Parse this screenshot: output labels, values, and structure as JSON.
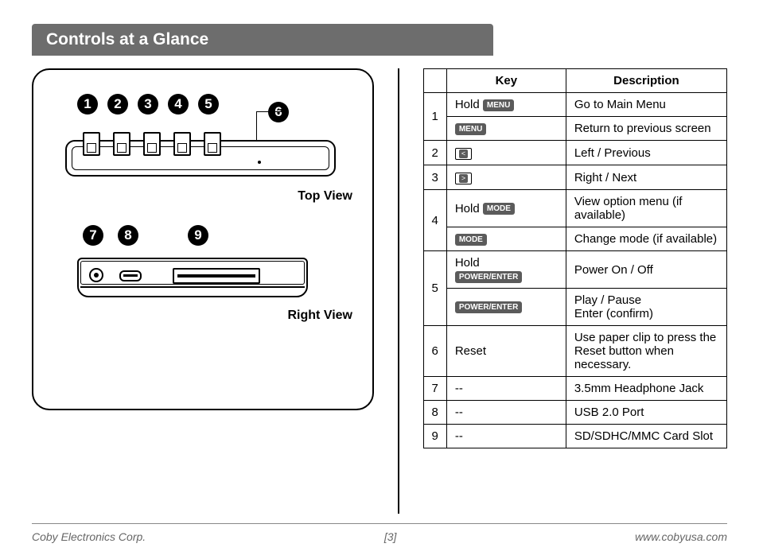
{
  "title": "Controls at a Glance",
  "diagram": {
    "top_numbers": [
      "1",
      "2",
      "3",
      "4",
      "5"
    ],
    "num6": "6",
    "top_view_label": "Top View",
    "bottom_numbers": [
      "7",
      "8",
      "9"
    ],
    "right_view_label": "Right View"
  },
  "table": {
    "header_key": "Key",
    "header_desc": "Description",
    "rows": {
      "r1a_key_prefix": "Hold",
      "r1a_btn": "MENU",
      "r1a_desc": "Go to Main Menu",
      "r1b_btn": "MENU",
      "r1b_desc": "Return to previous screen",
      "r2_arrow": "<",
      "r2_desc": "Left / Previous",
      "r3_arrow": ">",
      "r3_desc": "Right / Next",
      "r4a_key_prefix": "Hold",
      "r4a_btn": "MODE",
      "r4a_desc": "View option menu (if available)",
      "r4b_btn": "MODE",
      "r4b_desc": "Change mode (if available)",
      "r5a_key_prefix": "Hold",
      "r5a_btn": "POWER/ENTER",
      "r5a_desc": "Power On / Off",
      "r5b_btn": "POWER/ENTER",
      "r5b_desc": "Play / Pause\nEnter (confirm)",
      "r6_key": "Reset",
      "r6_desc": "Use paper clip to press the Reset button when necessary.",
      "r7_key": "--",
      "r7_desc": "3.5mm Headphone Jack",
      "r8_key": "--",
      "r8_desc": "USB 2.0 Port",
      "r9_key": "--",
      "r9_desc": "SD/SDHC/MMC Card Slot",
      "n1": "1",
      "n2": "2",
      "n3": "3",
      "n4": "4",
      "n5": "5",
      "n6": "6",
      "n7": "7",
      "n8": "8",
      "n9": "9"
    }
  },
  "footer": {
    "left": "Coby Electronics Corp.",
    "center": "[3]",
    "right": "www.cobyusa.com"
  }
}
